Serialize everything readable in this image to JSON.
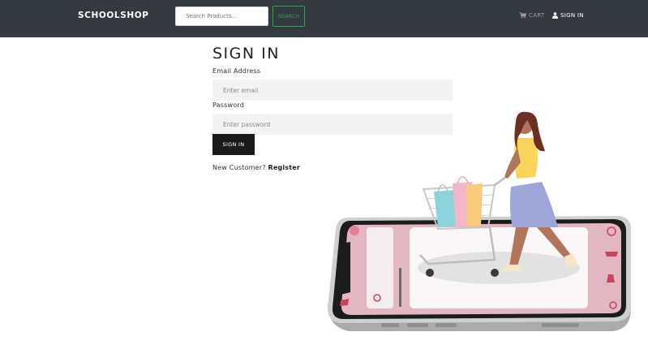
{
  "navbar": {
    "brand": "SCHOOLSHOP",
    "search_placeholder": "Search Products...",
    "search_button": "SEARCH",
    "cart_label": "CART",
    "signin_label": "SIGN IN",
    "icons": {
      "cart": "cart-icon",
      "user": "user-icon"
    }
  },
  "form": {
    "title": "SIGN IN",
    "email_label": "Email Address",
    "email_placeholder": "Enter email",
    "password_label": "Password",
    "password_placeholder": "Enter password",
    "submit_label": "SIGN IN",
    "new_customer_text": "New Customer?",
    "register_link": "Register"
  },
  "colors": {
    "navbar_bg": "#343a40",
    "search_button_accent": "#28a745",
    "submit_bg": "#1a1a1a",
    "field_bg": "#f3f3f3"
  }
}
